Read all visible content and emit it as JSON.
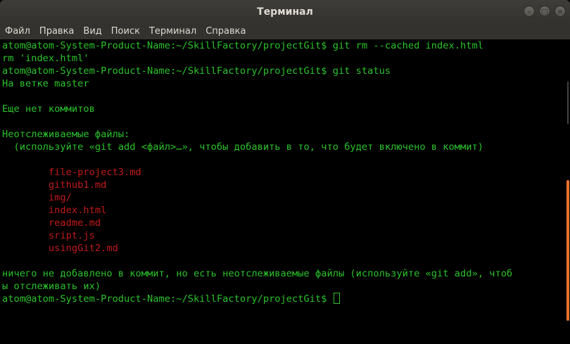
{
  "window": {
    "title": "Терминал"
  },
  "menu": {
    "items": [
      "Файл",
      "Правка",
      "Вид",
      "Поиск",
      "Терминал",
      "Справка"
    ]
  },
  "terminal": {
    "lines": [
      "atom@atom-System-Product-Name:~/SkillFactory/projectGit$ git rm --cached index.html",
      "rm 'index.html'",
      "atom@atom-System-Product-Name:~/SkillFactory/projectGit$ git status",
      "На ветке master",
      "",
      "Еще нет коммитов",
      "",
      "Неотслеживаемые файлы:",
      "  (используйте «git add <файл>…», чтобы добавить в то, что будет включено в коммит)",
      "",
      "        file-project3.md",
      "        github1.md",
      "        img/",
      "        index.html",
      "        readme.md",
      "        sript.js",
      "        usingGit2.md",
      "",
      "ничего не добавлено в коммит, но есть неотслеживаемые файлы (используйте «git add», чтоб",
      "ы отслеживать их)",
      "atom@atom-System-Product-Name:~/SkillFactory/projectGit$ "
    ]
  },
  "colors": {
    "text_green": "#2bc22b",
    "untracked_red": "#c31a1a",
    "background": "#000000",
    "scroll_thumb": "#e8732d"
  }
}
